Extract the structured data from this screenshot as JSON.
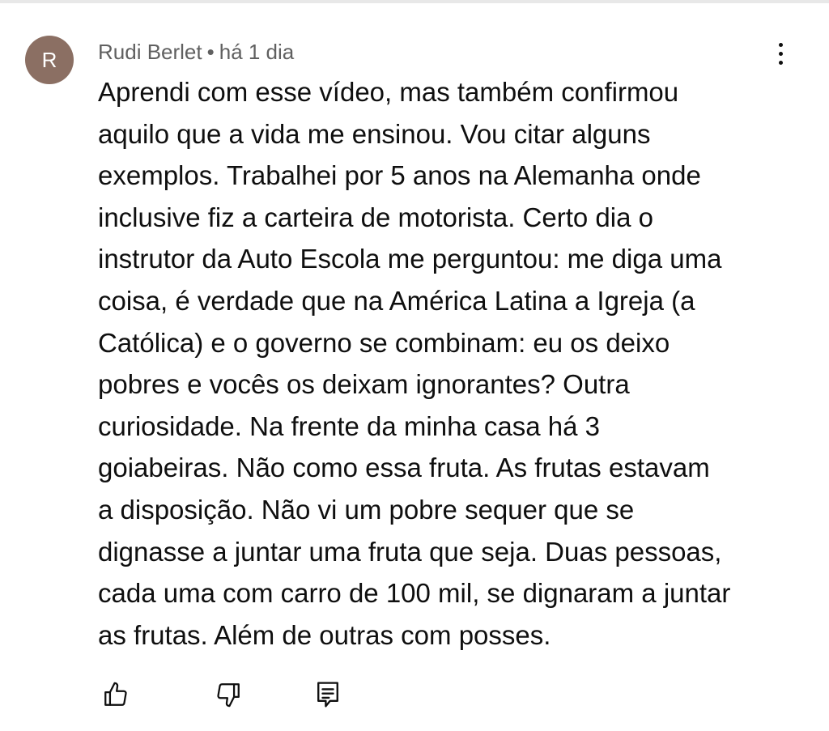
{
  "comment": {
    "avatar_initial": "R",
    "author": "Rudi Berlet",
    "separator": "•",
    "timestamp": "há 1 dia",
    "text_lines": [
      "Aprendi com esse vídeo, mas também confirmou",
      "aquilo que a vida me ensinou. Vou citar alguns",
      "exemplos. Trabalhei por 5 anos na Alemanha onde",
      "inclusive fiz a carteira de motorista. Certo dia o",
      "instrutor da Auto Escola me perguntou: me diga uma",
      "coisa, é verdade que na América Latina a Igreja (a",
      "Católica) e o governo se combinam: eu os deixo",
      "pobres e vocês os deixam ignorantes? Outra",
      "curiosidade. Na frente da minha casa há 3",
      "goiabeiras. Não como essa fruta. As frutas estavam",
      "a disposição. Não vi um pobre sequer que se",
      "dignasse a juntar uma fruta que seja. Duas pessoas,",
      "cada uma com carro de 100 mil, se dignaram a juntar",
      "as frutas. Além de outras com posses."
    ]
  },
  "actions": {
    "like_icon": "thumb-up-icon",
    "dislike_icon": "thumb-down-icon",
    "reply_icon": "reply-comment-icon",
    "menu_icon": "more-vertical-icon"
  },
  "colors": {
    "avatar_bg": "#8b6f63",
    "meta_text": "#606060",
    "body_text": "#0f0f0f"
  }
}
